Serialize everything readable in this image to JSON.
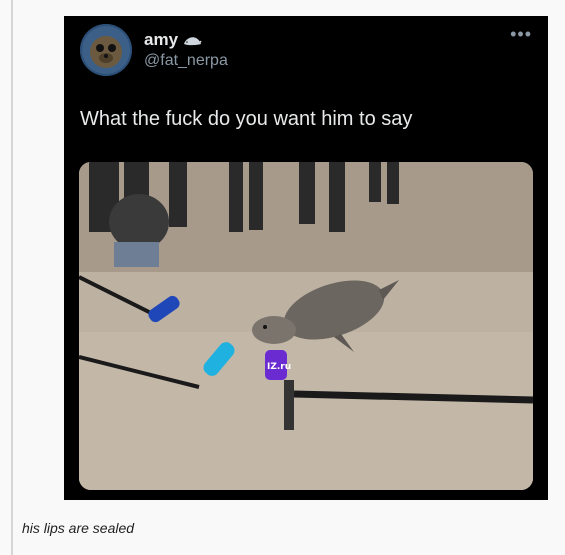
{
  "tweet": {
    "display_name": "amy",
    "name_emoji": "seal-icon",
    "handle": "@fat_nerpa",
    "text": "What the fuck do you want him to say",
    "more_icon": "ellipsis-icon",
    "more_label": "•••",
    "media_alt": "seal on a beach surrounded by reporters' microphones",
    "mic_label": "IZ.ru"
  },
  "post": {
    "caption": "his lips are sealed"
  },
  "colors": {
    "card_bg": "#000000",
    "text_primary": "#e7e9ea",
    "text_secondary": "#8b98a5",
    "page_bg": "#f9f9f9"
  }
}
